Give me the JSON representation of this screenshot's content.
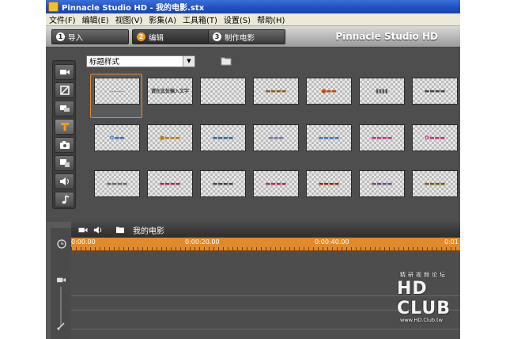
{
  "window": {
    "title": "Pinnacle Studio HD - 我的电影.stx"
  },
  "menu": [
    {
      "label": "文件(F)"
    },
    {
      "label": "编辑(E)"
    },
    {
      "label": "视图(V)"
    },
    {
      "label": "影集(A)"
    },
    {
      "label": "工具箱(T)"
    },
    {
      "label": "设置(S)"
    },
    {
      "label": "帮助(H)"
    }
  ],
  "tabs": [
    {
      "num": "1",
      "label": "导入"
    },
    {
      "num": "2",
      "label": "编辑"
    },
    {
      "num": "3",
      "label": "制作电影"
    }
  ],
  "brand": "Pinnacle Studio HD",
  "album": {
    "dropdown_value": "标题样式",
    "titles": [
      "",
      "请在此处输入文字",
      "",
      "",
      "",
      "",
      "",
      "",
      "",
      "",
      "",
      "",
      "",
      "",
      "",
      "",
      "",
      "",
      "",
      "",
      ""
    ]
  },
  "timeline": {
    "movie_title": "我的电影",
    "ruler": [
      "0:00.00",
      "0:00:20.00",
      "0:00:40.00",
      "0:01"
    ]
  },
  "watermark": {
    "small_text": "精研视频论坛",
    "logo": "HD CLUB",
    "url": "www.HD.Club.tw"
  },
  "colors": {
    "accent": "#f39a1c",
    "ruler": "#e08a2c",
    "titlebar": "#1f4fbf"
  }
}
